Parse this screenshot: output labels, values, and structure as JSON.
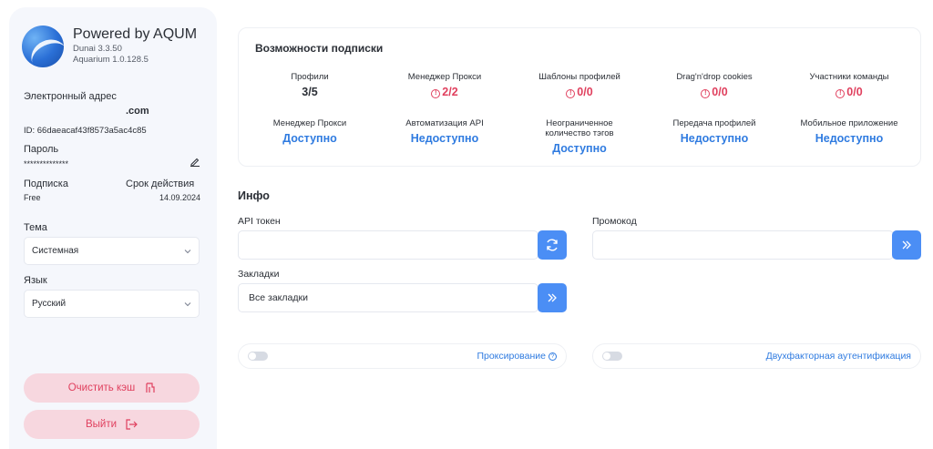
{
  "sidebar": {
    "brand_title": "Powered by AQUM",
    "version_dunai": "Dunai 3.3.50",
    "version_aquarium": "Aquarium 1.0.128.5",
    "email_label": "Электронный адрес",
    "email_value": ".com",
    "user_id": "ID: 66daeacaf43f8573a5ac4c85",
    "password_label": "Пароль",
    "password_value": "**************",
    "subscription_label": "Подписка",
    "subscription_value": "Free",
    "expiry_label": "Срок действия",
    "expiry_value": "14.09.2024",
    "theme_label": "Тема",
    "theme_value": "Системная",
    "language_label": "Язык",
    "language_value": "Русский",
    "clear_cache_label": "Очистить кэш",
    "logout_label": "Выйти"
  },
  "features": {
    "title": "Возможности подписки",
    "items": [
      {
        "label": "Профили",
        "value": "3/5",
        "status": "neutral"
      },
      {
        "label": "Менеджер Прокси",
        "value": "2/2",
        "status": "limit"
      },
      {
        "label": "Шаблоны профилей",
        "value": "0/0",
        "status": "limit"
      },
      {
        "label": "Drag'n'drop cookies",
        "value": "0/0",
        "status": "limit"
      },
      {
        "label": "Участники команды",
        "value": "0/0",
        "status": "limit"
      },
      {
        "label": "Менеджер Прокси",
        "value": "Доступно",
        "status": "available"
      },
      {
        "label": "Автоматизация API",
        "value": "Недоступно",
        "status": "unavailable"
      },
      {
        "label": "Неограниченное количество тэгов",
        "value": "Доступно",
        "status": "available"
      },
      {
        "label": "Передача профилей",
        "value": "Недоступно",
        "status": "unavailable"
      },
      {
        "label": "Мобильное приложение",
        "value": "Недоступно",
        "status": "unavailable"
      }
    ]
  },
  "info": {
    "title": "Инфо",
    "api_token_label": "API токен",
    "api_token_value": "",
    "promo_label": "Промокод",
    "promo_value": "",
    "bookmarks_label": "Закладки",
    "bookmarks_value": "Все закладки",
    "proxying_label": "Проксирование",
    "twofa_label": "Двухфакторная аутентификация"
  },
  "colors": {
    "accent_blue": "#4b8ef5",
    "danger": "#e0405e",
    "danger_bg": "#f7d7df"
  }
}
